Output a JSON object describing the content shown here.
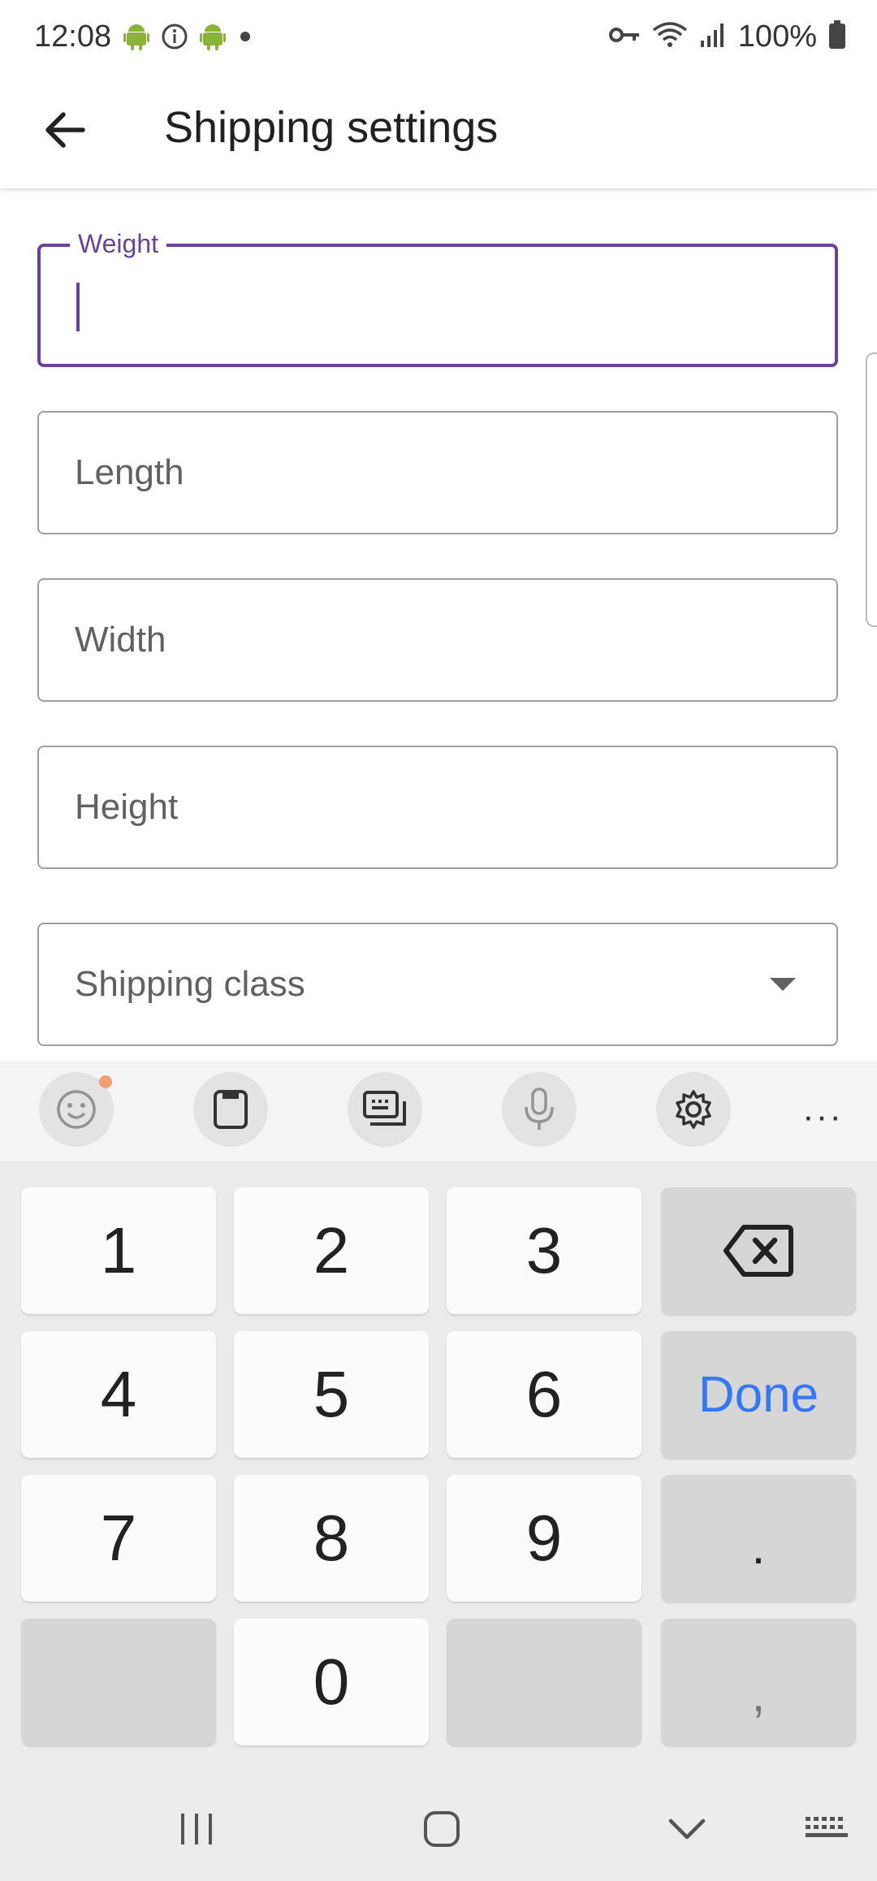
{
  "status_bar": {
    "time": "12:08",
    "battery": "100%"
  },
  "app_bar": {
    "title": "Shipping settings"
  },
  "form": {
    "weight": {
      "label": "Weight",
      "value": ""
    },
    "length": {
      "placeholder": "Length"
    },
    "width": {
      "placeholder": "Width"
    },
    "height": {
      "placeholder": "Height"
    },
    "shipping_class": {
      "placeholder": "Shipping class"
    }
  },
  "keyboard": {
    "keys": {
      "k1": "1",
      "k2": "2",
      "k3": "3",
      "k4": "4",
      "k5": "5",
      "k6": "6",
      "k7": "7",
      "k8": "8",
      "k9": "9",
      "k0": "0",
      "done": "Done",
      "period": ".",
      "comma": ","
    },
    "more": "···"
  },
  "colors": {
    "accent": "#674399",
    "done_blue": "#3478f6",
    "android_green": "#8bb33c"
  },
  "icons": {
    "status_left": [
      "android-icon",
      "info-icon",
      "android-icon",
      "dot-icon"
    ],
    "status_right": [
      "vpn-key-icon",
      "wifi-icon",
      "signal-icon",
      "battery-icon"
    ],
    "toolbar": [
      "emoji-icon",
      "clipboard-icon",
      "keyboard-mode-icon",
      "microphone-icon",
      "settings-icon",
      "more-icon"
    ]
  }
}
